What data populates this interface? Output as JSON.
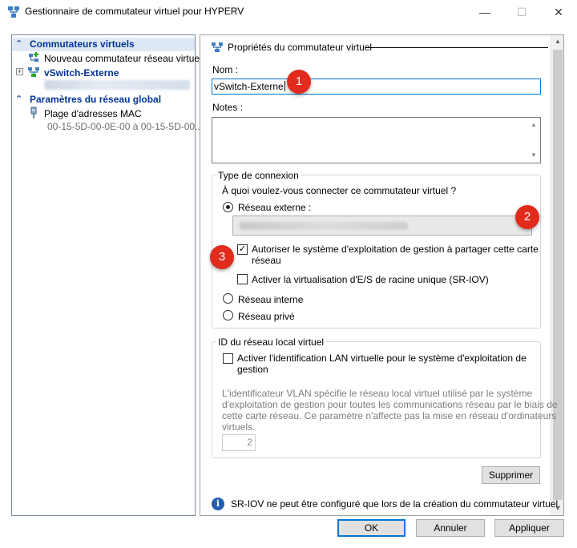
{
  "window": {
    "title": "Gestionnaire de commutateur virtuel pour HYPERV",
    "minimize_glyph": "—",
    "maximize_glyph": "☐",
    "close_glyph": "✕"
  },
  "tree": {
    "virtual_switches_header": "Commutateurs virtuels",
    "new_switch": "Nouveau commutateur réseau virtuel",
    "vswitch_name": "vSwitch-Externe",
    "global_settings_header": "Paramètres du réseau global",
    "mac_range_label": "Plage d'adresses MAC",
    "mac_range_value": "00-15-5D-00-0E-00 à 00-15-5D-00..."
  },
  "properties": {
    "group_title": "Propriétés du commutateur virtuel",
    "name_label": "Nom :",
    "name_value": "vSwitch-Externe",
    "notes_label": "Notes :",
    "notes_value": "",
    "connection_type_legend": "Type de connexion",
    "connection_question": "À quoi voulez-vous connecter ce commutateur virtuel ?",
    "external_network": "Réseau externe :",
    "allow_mgmt_os_line1": "Autoriser le système d'exploitation de gestion à partager cette carte",
    "allow_mgmt_os_line2": "réseau",
    "sriov_label": "Activer la virtualisation d'E/S de racine unique (SR-IOV)",
    "internal_network": "Réseau interne",
    "private_network": "Réseau privé",
    "vlan_legend": "ID du réseau local virtuel",
    "vlan_enable_line1": "Activer l'identification LAN virtuelle pour le système d'exploitation de",
    "vlan_enable_line2": "gestion",
    "vlan_description": [
      "L'identificateur VLAN spécifie le réseau local virtuel utilisé par le système",
      "d'exploitation de gestion pour toutes les communications réseau par le biais de",
      "cette carte réseau. Ce paramètre n'affecte pas la mise en réseau d'ordinateurs",
      "virtuels."
    ],
    "vlan_id_value": "2",
    "delete_button": "Supprimer",
    "sriov_info": "SR-IOV ne peut être configuré que lors de la création du commutateur virtuel."
  },
  "state": {
    "selected_connection": "external",
    "allow_mgmt_os_checked": true,
    "sriov_checked": false,
    "vlan_checked": false
  },
  "annotations": [
    "1",
    "2",
    "3"
  ],
  "footer": {
    "ok": "OK",
    "cancel": "Annuler",
    "apply": "Appliquer"
  },
  "colors": {
    "accent": "#0078d7",
    "tree_header": "#003399",
    "annotation_badge": "#e02b1d"
  }
}
